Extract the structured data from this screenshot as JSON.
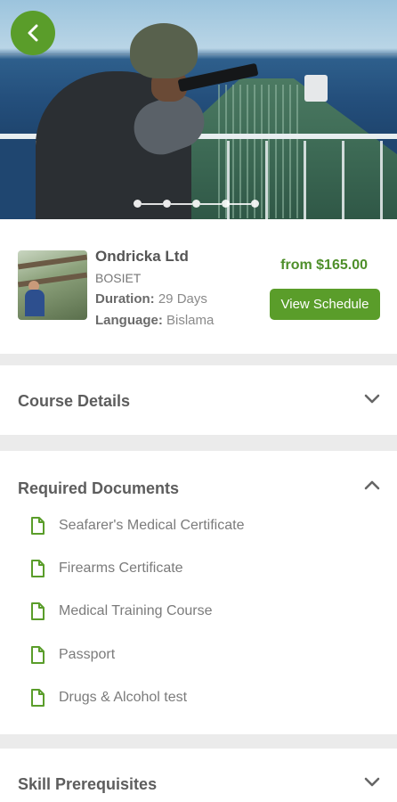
{
  "header": {
    "back_icon": "chevron-left-icon",
    "accent_color": "#5a9d2a"
  },
  "course": {
    "company": "Ondricka Ltd",
    "code": "BOSIET",
    "duration_label": "Duration:",
    "duration_value": "29 Days",
    "language_label": "Language:",
    "language_value": "Bislama",
    "price": "from $165.00",
    "schedule_label": "View Schedule"
  },
  "sections": {
    "course_details": {
      "title": "Course Details",
      "expanded": false
    },
    "required_documents": {
      "title": "Required Documents",
      "expanded": true,
      "items": [
        "Seafarer's Medical Certificate",
        "Firearms Certificate",
        "Medical Training Course",
        "Passport",
        "Drugs & Alcohol test"
      ]
    },
    "skill_prerequisites": {
      "title": "Skill Prerequisites",
      "expanded": false
    }
  }
}
